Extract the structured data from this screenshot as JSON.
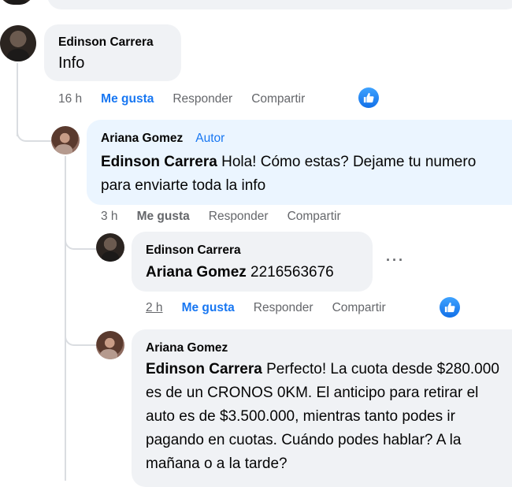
{
  "comments": [
    {
      "author": "Edinson Carrera",
      "body": "Info",
      "time": "16 h",
      "like_label": "Me gusta",
      "reply_label": "Responder",
      "share_label": "Compartir"
    },
    {
      "author": "Ariana Gomez",
      "author_tag": "Autor",
      "mention": "Edinson Carrera",
      "body": " Hola! Cómo estas? Dejame tu numero para enviarte toda la info",
      "time": "3 h",
      "like_label": "Me gusta",
      "reply_label": "Responder",
      "share_label": "Compartir"
    },
    {
      "author": "Edinson Carrera",
      "mention": "Ariana Gomez",
      "body": " 2216563676",
      "time": "2 h",
      "like_label": "Me gusta",
      "reply_label": "Responder",
      "share_label": "Compartir",
      "more": "···"
    },
    {
      "author": "Ariana Gomez",
      "mention": "Edinson Carrera",
      "body": " Perfecto! La cuota desde $280.000 es de un CRONOS 0KM. El anticipo para retirar el auto es de $3.500.000, mientras tanto podes ir pagando en cuotas. Cuándo podes hablar? A la mañana o a la tarde?"
    }
  ],
  "colors": {
    "accent": "#1877f2",
    "bubble": "#f0f2f5",
    "author_bubble": "#ebf5ff"
  },
  "icons": {
    "reaction": "thumbs-up-icon",
    "avatar_m": "avatar-male",
    "avatar_f": "avatar-female"
  }
}
